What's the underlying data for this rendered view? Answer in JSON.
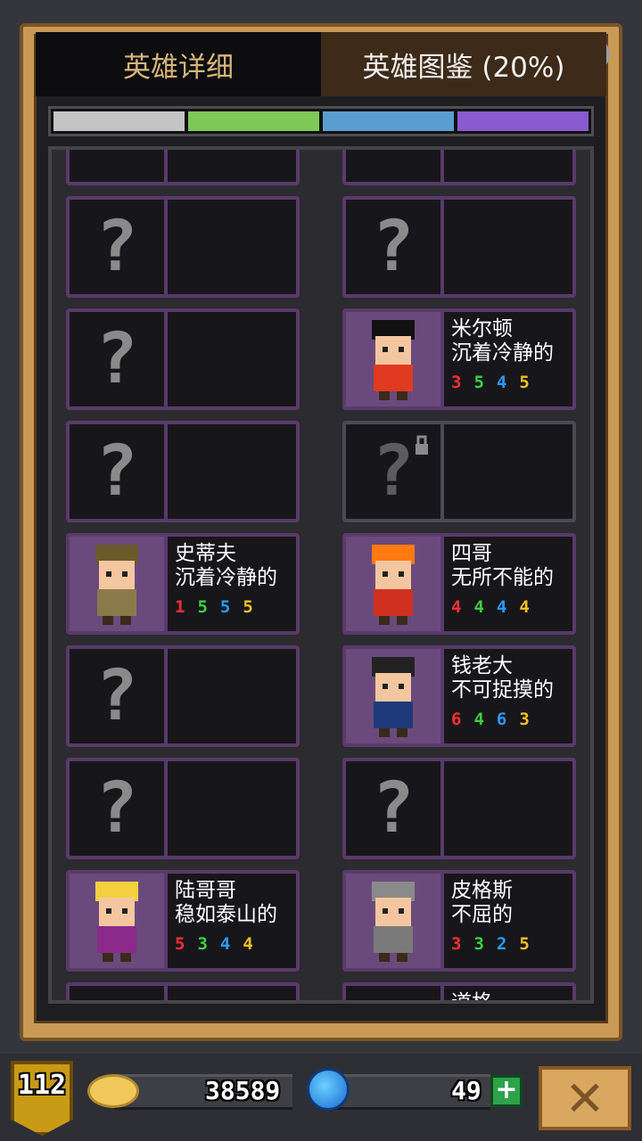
{
  "tabs": {
    "detail": "英雄详细",
    "collection": "英雄图鉴 (20%)"
  },
  "rarity_colors": [
    "#c4c4c4",
    "#7ec85a",
    "#5a9ed0",
    "#8a5ad0"
  ],
  "stat_colors": [
    "#ff3030",
    "#3ad040",
    "#2a9aff",
    "#f0c020"
  ],
  "heroes": [
    {
      "known": false
    },
    {
      "known": false
    },
    {
      "known": false
    },
    {
      "known": true,
      "name": "米尔顿",
      "trait": "沉着冷静的",
      "stats": [
        "3",
        "5",
        "4",
        "5"
      ],
      "portrait": "cowboy-hat-hero-icon"
    },
    {
      "known": false
    },
    {
      "known": false,
      "locked": true
    },
    {
      "known": true,
      "name": "史蒂夫",
      "trait": "沉着冷静的",
      "stats": [
        "1",
        "5",
        "5",
        "5"
      ],
      "portrait": "aviator-hero-icon"
    },
    {
      "known": true,
      "name": "四哥",
      "trait": "无所不能的",
      "stats": [
        "4",
        "4",
        "4",
        "4"
      ],
      "portrait": "flame-hair-hero-icon"
    },
    {
      "known": false
    },
    {
      "known": true,
      "name": "钱老大",
      "trait": "不可捉摸的",
      "stats": [
        "6",
        "4",
        "6",
        "3"
      ],
      "portrait": "spiky-hair-hero-icon"
    },
    {
      "known": false
    },
    {
      "known": false
    },
    {
      "known": true,
      "name": "陆哥哥",
      "trait": "稳如泰山的",
      "stats": [
        "5",
        "3",
        "4",
        "4"
      ],
      "portrait": "blonde-hero-icon"
    },
    {
      "known": true,
      "name": "皮格斯",
      "trait": "不屈的",
      "stats": [
        "3",
        "3",
        "2",
        "5"
      ],
      "portrait": "helmet-hero-icon"
    }
  ],
  "partial_bottom_name": "道格",
  "footer": {
    "level": "112",
    "coins": "38589",
    "gems": "49",
    "plus": "+",
    "close": "✕"
  }
}
